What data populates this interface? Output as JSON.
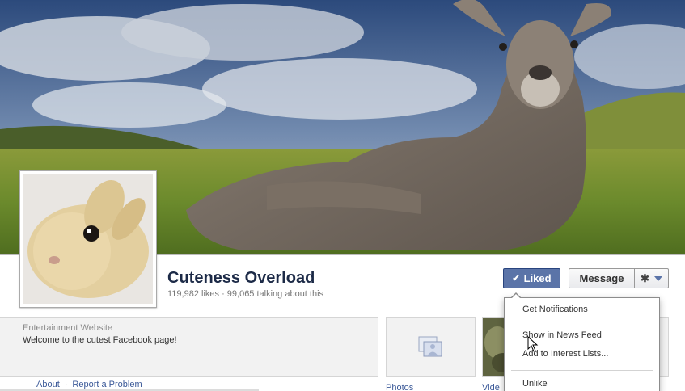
{
  "page": {
    "name": "Cuteness Overload",
    "stats": "119,982 likes · 99,065 talking about this"
  },
  "buttons": {
    "liked": "Liked",
    "message": "Message"
  },
  "about": {
    "category": "Entertainment Website",
    "description": "Welcome to the cutest Facebook page!",
    "link_about": "About",
    "link_report": "Report a Problem"
  },
  "apps": {
    "photos_label": "Photos",
    "videos_label": "Vide"
  },
  "menu": {
    "items": [
      "Get Notifications",
      "Show in News Feed",
      "Add to Interest Lists...",
      "Unlike"
    ]
  },
  "icons": {
    "check": "check-icon",
    "gear": "gear-icon",
    "caret": "chevron-down-icon",
    "photos": "photo-album-icon",
    "cursor": "mouse-pointer-icon"
  },
  "colors": {
    "liked_button": "#5b74a8",
    "link": "#3b5998",
    "name": "#1c2a47"
  }
}
